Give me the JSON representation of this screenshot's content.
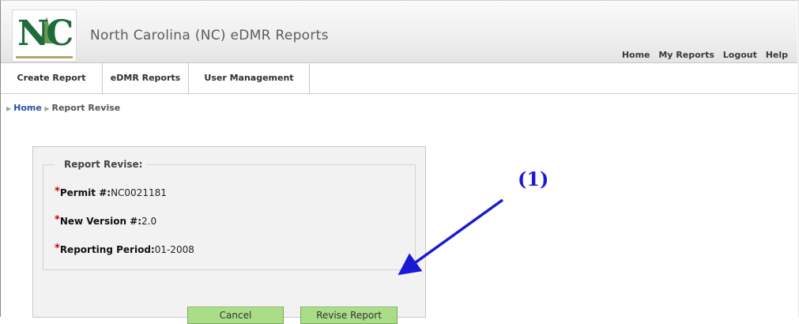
{
  "header": {
    "logo_text": "NC",
    "title": "North Carolina (NC) eDMR Reports",
    "links": [
      "Home",
      "My Reports",
      "Logout",
      "Help"
    ]
  },
  "tabs": [
    "Create Report",
    "eDMR Reports",
    "User Management"
  ],
  "breadcrumb": {
    "home": "Home",
    "current": "Report Revise"
  },
  "form": {
    "legend": "Report Revise:",
    "fields": [
      {
        "label": "Permit #:",
        "value": "NC0021181"
      },
      {
        "label": "New Version #:",
        "value": "2.0"
      },
      {
        "label": "Reporting Period:",
        "value": "01-2008"
      }
    ],
    "required_marker": "*",
    "cancel_label": "Cancel",
    "revise_label": "Revise Report"
  },
  "annotation": {
    "label": "(1)",
    "color": "#1a1ad6"
  },
  "colors": {
    "button_bg": "#aadd88",
    "link_blue": "#2451a6",
    "required_red": "#cc0000"
  }
}
